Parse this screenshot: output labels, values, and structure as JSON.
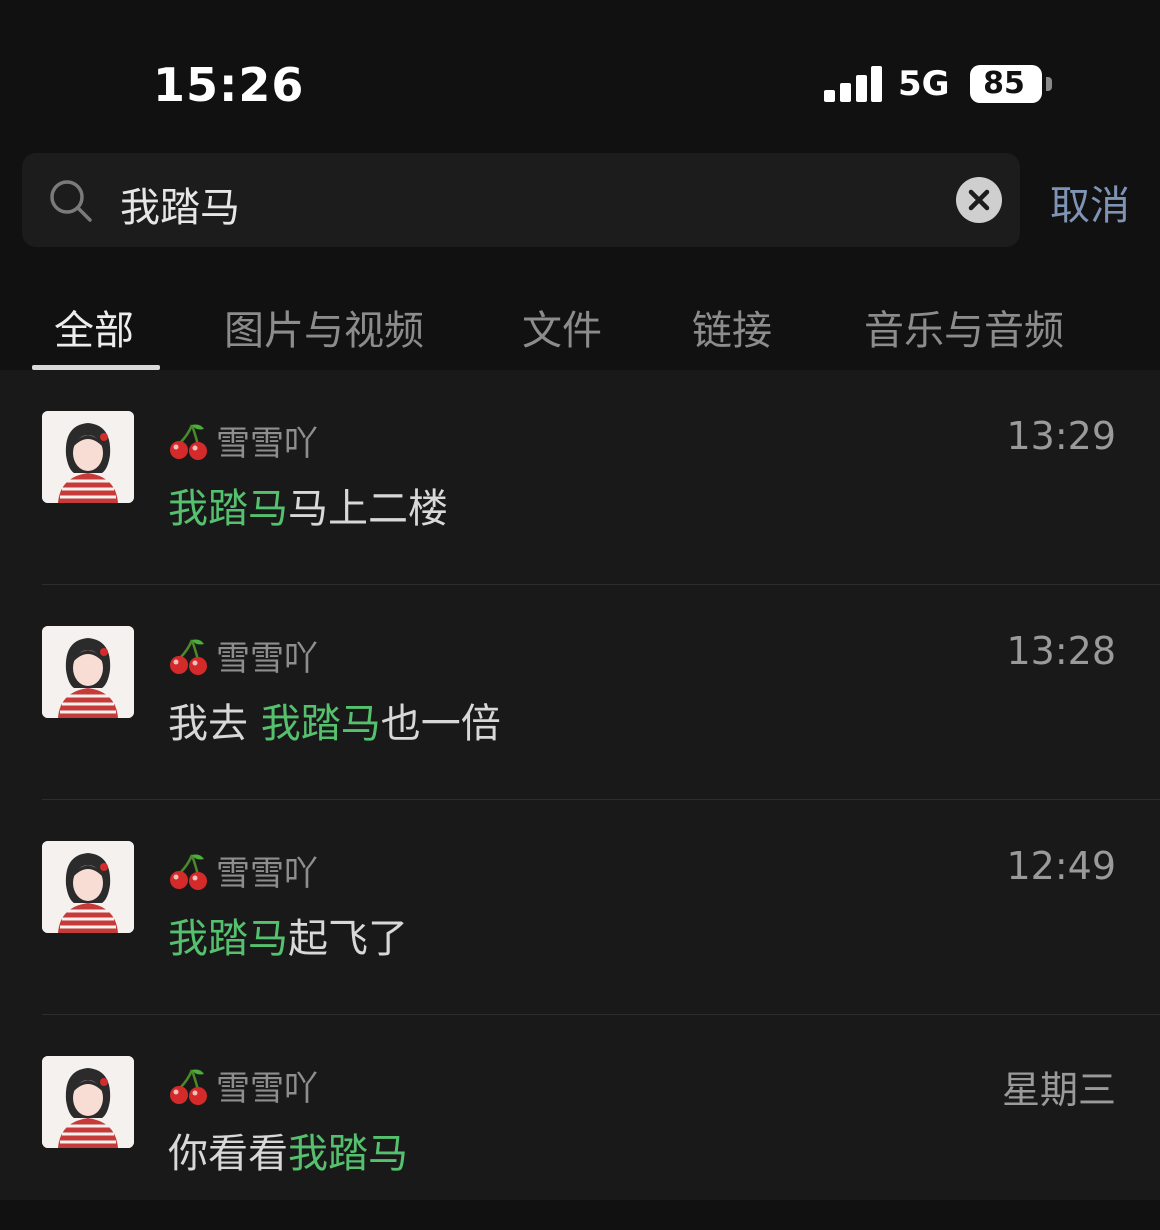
{
  "status_bar": {
    "time": "15:26",
    "network": "5G",
    "battery": "85"
  },
  "search": {
    "query": "我踏马",
    "cancel_label": "取消"
  },
  "tabs": [
    {
      "label": "全部",
      "active": true
    },
    {
      "label": "图片与视频",
      "active": false
    },
    {
      "label": "文件",
      "active": false
    },
    {
      "label": "链接",
      "active": false
    },
    {
      "label": "音乐与音频",
      "active": false
    }
  ],
  "colors": {
    "highlight": "#55c16e",
    "cancel": "#7f93b4",
    "background": "#111111"
  },
  "results": [
    {
      "sender": "雪雪吖",
      "sender_icon": "cherry-icon",
      "time": "13:29",
      "before": "",
      "highlight": "我踏马",
      "after": "马上二楼"
    },
    {
      "sender": "雪雪吖",
      "sender_icon": "cherry-icon",
      "time": "13:28",
      "before": "我去 ",
      "highlight": "我踏马",
      "after": "也一倍"
    },
    {
      "sender": "雪雪吖",
      "sender_icon": "cherry-icon",
      "time": "12:49",
      "before": "",
      "highlight": "我踏马",
      "after": "起飞了"
    },
    {
      "sender": "雪雪吖",
      "sender_icon": "cherry-icon",
      "time": "星期三",
      "before": "你看看",
      "highlight": "我踏马",
      "after": ""
    }
  ]
}
